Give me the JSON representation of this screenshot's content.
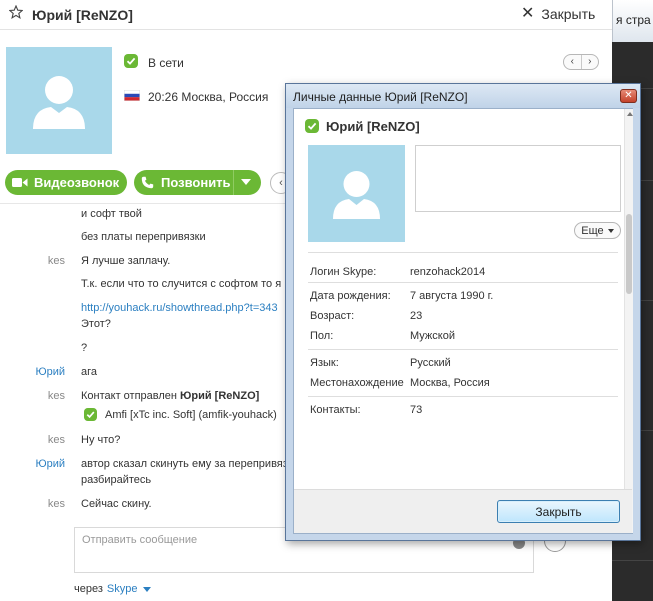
{
  "main": {
    "contact_name": "Юрий [ReNZO]",
    "close_label": "Закрыть",
    "status": "В сети",
    "location": "20:26 Москва, Россия",
    "video_call_label": "Видеозвонок",
    "call_label": "Позвонить"
  },
  "chat": {
    "messages": [
      {
        "sender": "",
        "text": "и софт твой"
      },
      {
        "sender": "",
        "text": "без платы перепривязки"
      },
      {
        "sender": "kes",
        "text": "Я лучше заплачу."
      },
      {
        "sender": "",
        "text": "Т.к. если что то случится с софтом то я"
      },
      {
        "sender": "",
        "text": "http://youhack.ru/showthread.php?t=343"
      },
      {
        "sender": "",
        "text": "Этот?"
      },
      {
        "sender": "",
        "text": "?"
      },
      {
        "sender": "Юрий",
        "text": "ага"
      },
      {
        "sender": "kes",
        "text_prefix": "Контакт отправлен ",
        "text_bold": "Юрий [ReNZO]"
      },
      {
        "sender": "",
        "text": "Amfi [xTc inc. Soft] (amfik-youhack)"
      },
      {
        "sender": "kes",
        "text": "Ну что?"
      },
      {
        "sender": "Юрий",
        "text": "автор сказал скинуть ему за перепривяз"
      },
      {
        "sender": "",
        "text": "разбирайтесь"
      },
      {
        "sender": "kes",
        "text": "Сейчас скину."
      }
    ],
    "input_placeholder": "Отправить сообщение",
    "via_label": "через",
    "via_service": "Skype"
  },
  "background_window": {
    "tab_text": "я стра"
  },
  "dialog": {
    "title": "Личные данные Юрий [ReNZO]",
    "name": "Юрий [ReNZO]",
    "more_label": "Еще",
    "fields": {
      "skype_login": {
        "label": "Логин Skype:",
        "value": "renzohack2014"
      },
      "birthdate": {
        "label": "Дата рождения:",
        "value": "7 августа 1990 г."
      },
      "age": {
        "label": "Возраст:",
        "value": "23"
      },
      "gender": {
        "label": "Пол:",
        "value": "Мужской"
      },
      "language": {
        "label": "Язык:",
        "value": "Русский"
      },
      "location": {
        "label": "Местонахождение",
        "value": "Москва, Россия"
      },
      "contacts": {
        "label": "Контакты:",
        "value": "73"
      }
    },
    "close_button_label": "Закрыть"
  },
  "colors": {
    "skype_green": "#6bb835",
    "avatar_bg": "#a9d8ea",
    "link_blue": "#2b7fc1",
    "dialog_frame": "#c5d6ea"
  }
}
